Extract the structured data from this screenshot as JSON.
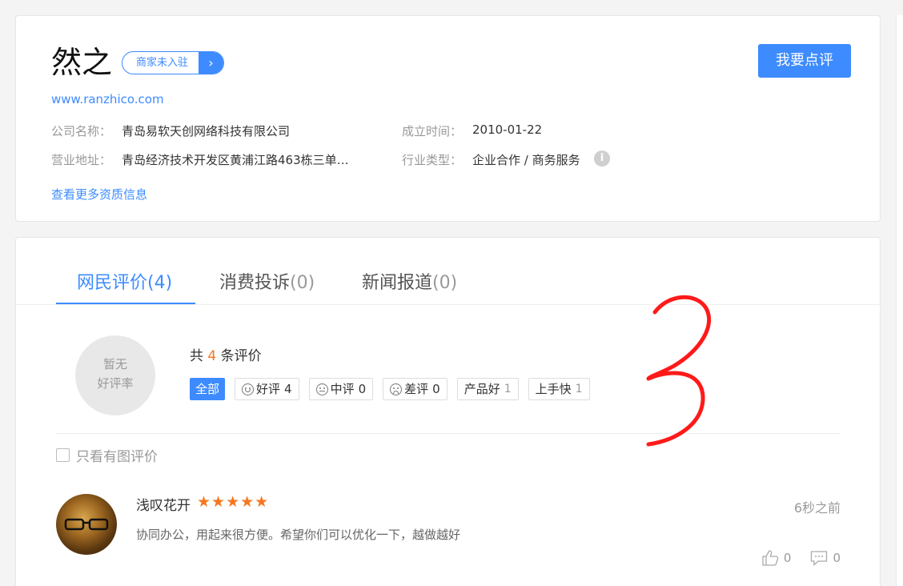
{
  "company": {
    "name": "然之",
    "merchant_badge": "商家未入驻",
    "review_button": "我要点评",
    "website": "www.ranzhico.com",
    "company_name_label": "公司名称：",
    "company_name_value": "青岛易软天创网络科技有限公司",
    "address_label": "营业地址：",
    "address_value": "青岛经济技术开发区黄浦江路463栋三单…",
    "founded_label": "成立时间：",
    "founded_value": "2010-01-22",
    "industry_label": "行业类型：",
    "industry_value": "企业合作 / 商务服务",
    "more_info_link": "查看更多资质信息"
  },
  "tabs": [
    {
      "label": "网民评价",
      "count": "(4)"
    },
    {
      "label": "消费投诉",
      "count": "(0)"
    },
    {
      "label": "新闻报道",
      "count": "(0)"
    }
  ],
  "summary": {
    "rating_line1": "暂无",
    "rating_line2": "好评率",
    "total_prefix": "共",
    "total_count": "4",
    "total_suffix": "条评价"
  },
  "filters": [
    {
      "label": "全部",
      "count": ""
    },
    {
      "label": "好评",
      "count": "4"
    },
    {
      "label": "中评",
      "count": "0"
    },
    {
      "label": "差评",
      "count": "0"
    },
    {
      "label": "产品好",
      "count": "1"
    },
    {
      "label": "上手快",
      "count": "1"
    }
  ],
  "photo_filter_label": "只看有图评价",
  "review": {
    "reviewer": "浅叹花开",
    "rating": 5,
    "time": "6秒之前",
    "text": "协同办公，用起来很方便。希望你们可以优化一下，越做越好",
    "likes": "0",
    "comments": "0"
  },
  "colors": {
    "accent": "#3d8bff",
    "star": "#f5771f",
    "annotation": "#ff1a1a"
  }
}
